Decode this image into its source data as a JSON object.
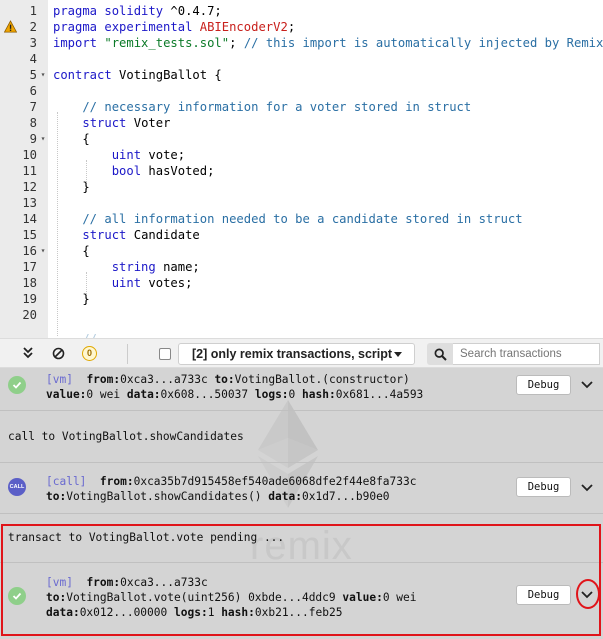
{
  "editor": {
    "lines": [
      {
        "n": "1",
        "fold": false,
        "warn": false,
        "segments": [
          {
            "t": "pragma solidity ",
            "c": "kw"
          },
          {
            "t": "^0.4.7;",
            "c": ""
          }
        ]
      },
      {
        "n": "2",
        "fold": false,
        "warn": true,
        "segments": [
          {
            "t": "pragma experimental ",
            "c": "kw"
          },
          {
            "t": "ABIEncoderV2",
            "c": "red"
          },
          {
            "t": ";",
            "c": ""
          }
        ]
      },
      {
        "n": "3",
        "fold": false,
        "warn": false,
        "segments": [
          {
            "t": "import ",
            "c": "kw"
          },
          {
            "t": "\"remix_tests.sol\"",
            "c": "str"
          },
          {
            "t": "; ",
            "c": ""
          },
          {
            "t": "// this import is automatically injected by Remix.",
            "c": "cmt"
          }
        ]
      },
      {
        "n": "4",
        "fold": false,
        "warn": false,
        "segments": []
      },
      {
        "n": "5",
        "fold": true,
        "warn": false,
        "segments": [
          {
            "t": "contract ",
            "c": "kw"
          },
          {
            "t": "VotingBallot {",
            "c": ""
          }
        ]
      },
      {
        "n": "6",
        "fold": false,
        "warn": false,
        "segments": []
      },
      {
        "n": "7",
        "fold": false,
        "warn": false,
        "segments": [
          {
            "t": "    // necessary information for a voter stored in struct",
            "c": "cmt"
          }
        ]
      },
      {
        "n": "8",
        "fold": false,
        "warn": false,
        "segments": [
          {
            "t": "    ",
            "c": ""
          },
          {
            "t": "struct ",
            "c": "kw"
          },
          {
            "t": "Voter",
            "c": ""
          }
        ]
      },
      {
        "n": "9",
        "fold": true,
        "warn": false,
        "segments": [
          {
            "t": "    {",
            "c": ""
          }
        ]
      },
      {
        "n": "10",
        "fold": false,
        "warn": false,
        "segments": [
          {
            "t": "        ",
            "c": ""
          },
          {
            "t": "uint ",
            "c": "typ"
          },
          {
            "t": "vote;",
            "c": ""
          }
        ]
      },
      {
        "n": "11",
        "fold": false,
        "warn": false,
        "segments": [
          {
            "t": "        ",
            "c": ""
          },
          {
            "t": "bool ",
            "c": "typ"
          },
          {
            "t": "hasVoted;",
            "c": ""
          }
        ]
      },
      {
        "n": "12",
        "fold": false,
        "warn": false,
        "segments": [
          {
            "t": "    }",
            "c": ""
          }
        ]
      },
      {
        "n": "13",
        "fold": false,
        "warn": false,
        "segments": []
      },
      {
        "n": "14",
        "fold": false,
        "warn": false,
        "segments": [
          {
            "t": "    // all information needed to be a candidate stored in struct",
            "c": "cmt"
          }
        ]
      },
      {
        "n": "15",
        "fold": false,
        "warn": false,
        "segments": [
          {
            "t": "    ",
            "c": ""
          },
          {
            "t": "struct ",
            "c": "kw"
          },
          {
            "t": "Candidate",
            "c": ""
          }
        ]
      },
      {
        "n": "16",
        "fold": true,
        "warn": false,
        "segments": [
          {
            "t": "    {",
            "c": ""
          }
        ]
      },
      {
        "n": "17",
        "fold": false,
        "warn": false,
        "segments": [
          {
            "t": "        ",
            "c": ""
          },
          {
            "t": "string ",
            "c": "typ"
          },
          {
            "t": "name;",
            "c": ""
          }
        ]
      },
      {
        "n": "18",
        "fold": false,
        "warn": false,
        "segments": [
          {
            "t": "        ",
            "c": ""
          },
          {
            "t": "uint ",
            "c": "typ"
          },
          {
            "t": "votes;",
            "c": ""
          }
        ]
      },
      {
        "n": "19",
        "fold": false,
        "warn": false,
        "segments": [
          {
            "t": "    }",
            "c": ""
          }
        ]
      },
      {
        "n": "20",
        "fold": false,
        "warn": false,
        "segments": []
      }
    ]
  },
  "toolbar": {
    "warning_count": "0",
    "filter_label": "[2] only remix transactions, script",
    "search_placeholder": "Search transactions"
  },
  "terminal": {
    "watermark": "remix",
    "log1": {
      "tag": "[vm]",
      "from_label": "from:",
      "from_value": "0xca3...a733c",
      "to_label": "to:",
      "to_value": "VotingBallot.(constructor)",
      "value_label": "value:",
      "value_value": "0 wei",
      "data_label": "data:",
      "data_value": "0x608...50037",
      "logs_label": "logs:",
      "logs_value": "0",
      "hash_label": "hash:",
      "hash_value": "0x681...4a593",
      "debug_label": "Debug"
    },
    "call_text": "call to VotingBallot.showCandidates",
    "log2": {
      "icon_label": "CALL",
      "tag": "[call]",
      "from_label": "from:",
      "from_value": "0xca35b7d915458ef540ade6068dfe2f44e8fa733c",
      "to_label": "to:",
      "to_value": "VotingBallot.showCandidates()",
      "data_label": "data:",
      "data_value": "0x1d7...b90e0",
      "debug_label": "Debug"
    },
    "pending_text": "transact to VotingBallot.vote pending ...",
    "log3": {
      "tag": "[vm]",
      "from_label": "from:",
      "from_value": "0xca3...a733c",
      "to_label": "to:",
      "to_value": "VotingBallot.vote(uint256) 0xbde...4ddc9",
      "value_label": "value:",
      "value_value": "0 wei",
      "data_label": "data:",
      "data_value": "0x012...00000",
      "logs_label": "logs:",
      "logs_value": "1",
      "hash_label": "hash:",
      "hash_value": "0xb21...feb25",
      "debug_label": "Debug"
    }
  },
  "colors": {
    "keyword": "#1c18c8",
    "string": "#0b7a28",
    "comment": "#2a6fa4",
    "highlight": "#e0141a"
  }
}
